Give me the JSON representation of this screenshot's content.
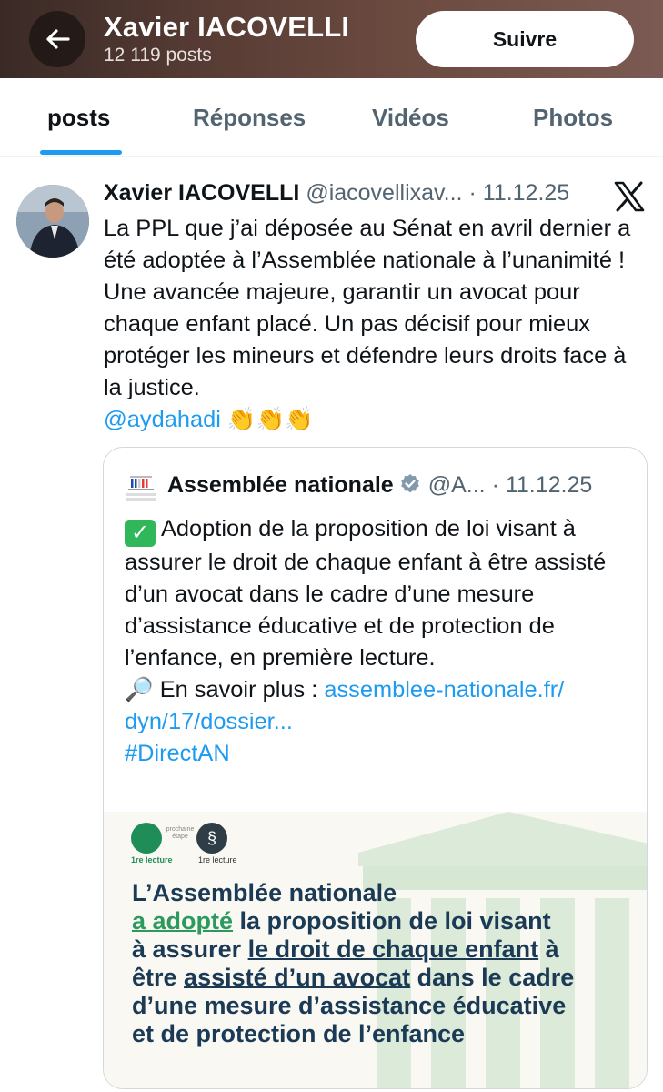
{
  "header": {
    "name": "Xavier IACOVELLI",
    "post_count": "12 119 posts",
    "follow_label": "Suivre",
    "background_color": "#5a3e36"
  },
  "tabs": [
    {
      "label": "posts",
      "active": true
    },
    {
      "label": "Réponses",
      "active": false
    },
    {
      "label": "Vidéos",
      "active": false
    },
    {
      "label": "Photos",
      "active": false
    }
  ],
  "post": {
    "author_name": "Xavier IACOVELLI",
    "author_handle": "@iacovellixav...",
    "date": "· 11.12.25",
    "text": "La PPL que j’ai déposée au Sénat en avril dernier a été adoptée à l’Assemblée nationale à l’unanimité ! Une avancée majeure, garantir un avocat pour chaque enfant placé. Un pas décisif pour mieux protéger les mineurs et défendre leurs droits face à la justice.",
    "mention": "@aydahadi",
    "emojis": "👏👏👏",
    "source_icon": "x-logo-icon"
  },
  "quote": {
    "author_name": "Assemblée nationale",
    "verified": true,
    "handle": "@A...",
    "date": "· 11.12.25",
    "text": "Adoption de la proposition de loi visant à assurer le droit de chaque enfant à être assisté d’un avocat dans le cadre d’une mesure d’assistance éducative et de protection de l’enfance, en première lecture.",
    "more_label": "En savoir plus :",
    "link": "assemblee-nationale.fr/ dyn/17/dossier...",
    "hashtag": "#DirectAN",
    "image": {
      "step1_label": "1re lecture",
      "step_next_label": "prochaine étape",
      "step2_label": "1re lecture",
      "line1": "L’Assemblée nationale",
      "adopted": "a adopté",
      "line2_rest": " la proposition de loi visant",
      "line3_start": "à assurer ",
      "right_phrase": "le droit de chaque enfant",
      "line3_end": " à",
      "line4_start": "être ",
      "assisted_phrase": "assisté d’un avocat",
      "line4_end": " dans le cadre",
      "line5": "d’une mesure d’assistance éducative",
      "line6": "et de protection de l’enfance"
    }
  },
  "colors": {
    "link": "#1d9bf0",
    "tab_indicator": "#1d9bf0",
    "verified": "#829aab",
    "image_text": "#1a3a55",
    "image_green": "#2c9a5e"
  }
}
